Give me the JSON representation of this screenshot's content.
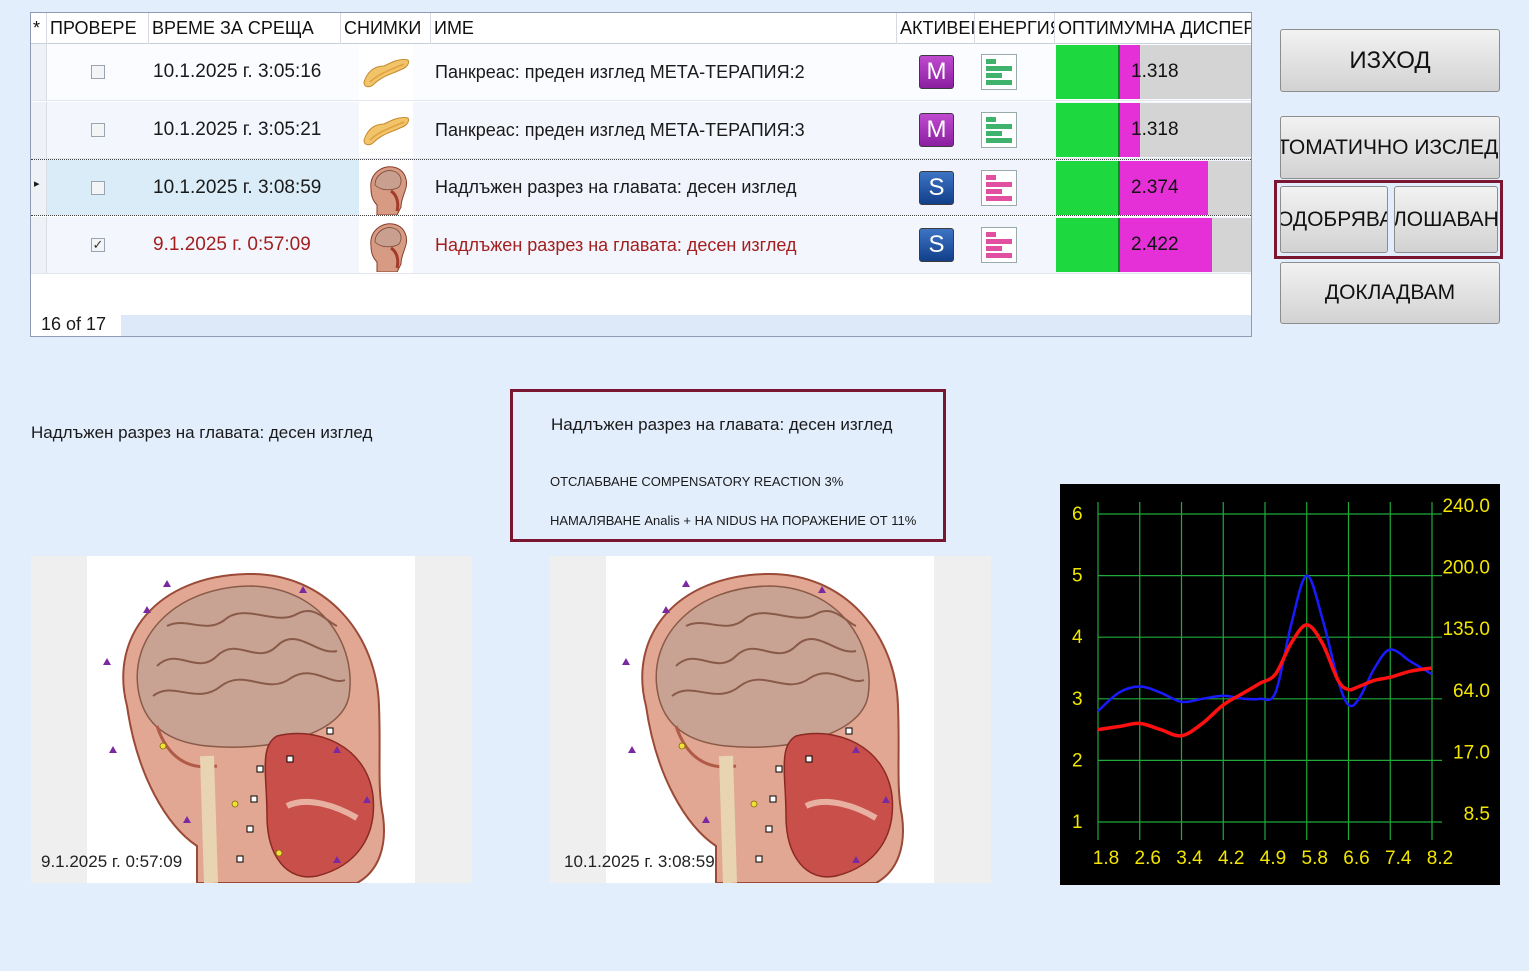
{
  "grid": {
    "columns": {
      "marker": "*",
      "check": "ПРОВЕРЕ",
      "sort_arrow": "▲",
      "time": "ВРЕМЕ ЗА СРЕЩА",
      "images": "СНИМКИ",
      "name": "ИМЕ",
      "active": "АКТИВЕІ",
      "energy": "ЕНЕРГИЯ",
      "dispersion": "ОПТИМУМНА ДИСПЕР"
    },
    "rows": [
      {
        "time": "10.1.2025 г. 3:05:16",
        "name": "Панкреас: преден изглед МЕТА-ТЕРАПИЯ:2",
        "active": "M",
        "value": "1.318",
        "fill": 0.1,
        "checked": false
      },
      {
        "time": "10.1.2025 г. 3:05:21",
        "name": "Панкреас: преден изглед МЕТА-ТЕРАПИЯ:3",
        "active": "M",
        "value": "1.318",
        "fill": 0.1,
        "checked": false
      },
      {
        "time": "10.1.2025 г. 3:08:59",
        "name": "Надлъжен разрез на главата: десен изглед",
        "active": "S",
        "value": "2.374",
        "fill": 0.68,
        "checked": false
      },
      {
        "time": "9.1.2025 г. 0:57:09",
        "name": "Надлъжен разрез на главата: десен изглед",
        "active": "S",
        "value": "2.422",
        "fill": 0.7,
        "checked": true
      }
    ],
    "row_marker": "▸",
    "check_mark": "✓",
    "footer": "16 of 17"
  },
  "buttons": {
    "exit": "ИЗХОД",
    "auto": "ТОМАТИЧНО ИЗСЛЕДВА",
    "approve": "ОДОБРЯВАН",
    "worse": "ЛОШАВАН",
    "report": "ДОКЛАДВАМ"
  },
  "left_title": "Надлъжен разрез на главата: десен изглед",
  "info": {
    "title": "Надлъжен разрез на главата: десен изглед",
    "line1": "ОТСЛАБВАНЕ COMPENSATORY REACTION 3%",
    "line2": "НАМАЛЯВАНЕ Analis + НА NIDUS НА ПОРАЖЕНИЕ ОТ 11%"
  },
  "images": {
    "left_date": "9.1.2025 г. 0:57:09",
    "right_date": "10.1.2025 г. 3:08:59"
  },
  "chart_data": {
    "type": "line",
    "y_left_ticks": [
      "6",
      "5",
      "4",
      "3",
      "2",
      "1"
    ],
    "y_right_ticks": [
      "240.0",
      "200.0",
      "135.0",
      "64.0",
      "17.0",
      "8.5"
    ],
    "x_ticks": [
      "1.8",
      "2.6",
      "3.4",
      "4.2",
      "4.9",
      "5.8",
      "6.6",
      "7.4",
      "8.2"
    ],
    "xlim": [
      1.8,
      8.2
    ],
    "ylim": [
      1,
      6
    ],
    "grid": true,
    "series": [
      {
        "color": "#1a1aff",
        "x": [
          1.8,
          2.2,
          2.6,
          3.0,
          3.4,
          3.8,
          4.2,
          4.6,
          4.9,
          5.2,
          5.5,
          5.8,
          6.1,
          6.4,
          6.6,
          6.8,
          7.1,
          7.4,
          7.8,
          8.2
        ],
        "y": [
          2.8,
          3.1,
          3.2,
          3.1,
          2.95,
          3.0,
          3.05,
          3.0,
          3.0,
          3.1,
          4.2,
          5.0,
          4.3,
          3.3,
          2.9,
          3.0,
          3.5,
          3.8,
          3.6,
          3.4
        ]
      },
      {
        "color": "#ff1010",
        "x": [
          1.8,
          2.2,
          2.6,
          3.0,
          3.4,
          3.8,
          4.2,
          4.6,
          4.9,
          5.2,
          5.5,
          5.8,
          6.1,
          6.4,
          6.6,
          6.8,
          7.1,
          7.4,
          7.8,
          8.2
        ],
        "y": [
          2.5,
          2.55,
          2.6,
          2.5,
          2.4,
          2.6,
          2.9,
          3.1,
          3.25,
          3.4,
          3.9,
          4.2,
          3.9,
          3.3,
          3.15,
          3.2,
          3.3,
          3.35,
          3.45,
          3.5
        ]
      }
    ]
  }
}
